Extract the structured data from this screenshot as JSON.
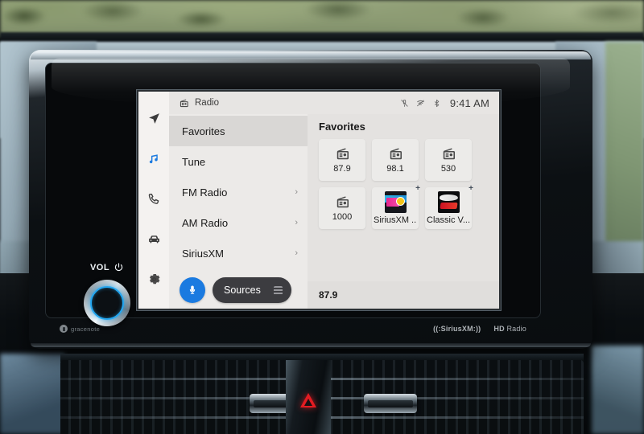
{
  "vehicle": {
    "volume_label": "VOL",
    "brands": {
      "gracenote": "gracenote",
      "siriusxm": "((:SiriusXM:))",
      "hd_prefix": "HD",
      "hd_radio": "Radio"
    }
  },
  "screen": {
    "status": {
      "source_title": "Radio",
      "source_icon": "radio-icon",
      "icons": [
        "mic-muted-icon",
        "signal-off-icon",
        "bluetooth-icon"
      ],
      "clock": "9:41 AM"
    },
    "rail": [
      {
        "name": "navigation",
        "icon": "navigation-arrow-icon",
        "active": false
      },
      {
        "name": "media",
        "icon": "music-note-icon",
        "active": true
      },
      {
        "name": "phone",
        "icon": "phone-icon",
        "active": false
      },
      {
        "name": "vehicle",
        "icon": "car-icon",
        "active": false
      },
      {
        "name": "settings",
        "icon": "gear-icon",
        "active": false
      }
    ],
    "menu": {
      "items": [
        {
          "label": "Favorites",
          "active": true,
          "chevron": ""
        },
        {
          "label": "Tune",
          "active": false,
          "chevron": ""
        },
        {
          "label": "FM Radio",
          "active": false,
          "chevron": "›"
        },
        {
          "label": "AM Radio",
          "active": false,
          "chevron": "›"
        },
        {
          "label": "SiriusXM",
          "active": false,
          "chevron": "›"
        }
      ],
      "mic_icon": "microphone-icon",
      "sources_label": "Sources",
      "sources_icon": "list-icon"
    },
    "content": {
      "title": "Favorites",
      "tiles": [
        {
          "label": "87.9",
          "type": "radio",
          "plus": false
        },
        {
          "label": "98.1",
          "type": "radio",
          "plus": false
        },
        {
          "label": "530",
          "type": "radio",
          "plus": false
        },
        {
          "label": "1000",
          "type": "radio",
          "plus": false
        },
        {
          "label": "SiriusXM ...",
          "type": "art-hits1",
          "plus": true,
          "plus_label": "+"
        },
        {
          "label": "Classic V...",
          "type": "art-vinyl",
          "plus": true,
          "plus_label": "+"
        }
      ],
      "now_playing": "87.9"
    },
    "colors": {
      "accent_blue": "#1a7ae0",
      "knob_ring": "#23a6f0",
      "screen_bg": "#f2f0ee",
      "menu_bg": "#eceae8",
      "active_row": "#d9d7d5",
      "sources_pill": "#3c3c40",
      "hazard_red": "#e31c22"
    }
  }
}
